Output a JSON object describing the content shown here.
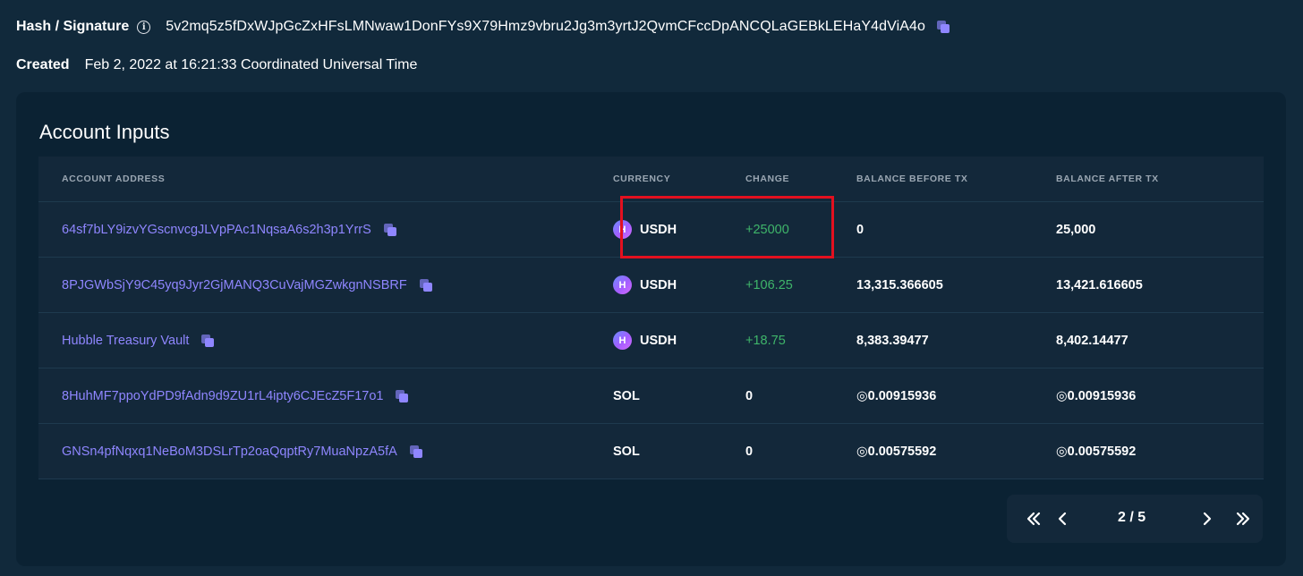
{
  "hash": {
    "label": "Hash / Signature",
    "info_icon": "info-icon",
    "value": "5v2mq5z5fDxWJpGcZxHFsLMNwaw1DonFYs9X79Hmz9vbru2Jg3m3yrtJ2QvmCFccDpANCQLaGEBkLEHaY4dViA4o",
    "copy_icon": "copy-icon"
  },
  "created": {
    "label": "Created",
    "value": "Feb 2, 2022 at 16:21:33 Coordinated Universal Time"
  },
  "account_inputs": {
    "title": "Account Inputs",
    "columns": [
      "ACCOUNT ADDRESS",
      "CURRENCY",
      "CHANGE",
      "BALANCE BEFORE TX",
      "BALANCE AFTER TX"
    ],
    "rows": [
      {
        "address": "64sf7bLY9izvYGscnvcgJLVpPAc1NqsaA6s2h3p1YrrS",
        "currency": "USDH",
        "currency_icon_letter": "H",
        "change": "+25000",
        "before": "0",
        "after": "25,000"
      },
      {
        "address": "8PJGWbSjY9C45yq9Jyr2GjMANQ3CuVajMGZwkgnNSBRF",
        "currency": "USDH",
        "currency_icon_letter": "H",
        "change": "+106.25",
        "before": "13,315.366605",
        "after": "13,421.616605"
      },
      {
        "address": "Hubble Treasury Vault",
        "currency": "USDH",
        "currency_icon_letter": "H",
        "change": "+18.75",
        "before": "8,383.39477",
        "after": "8,402.14477"
      },
      {
        "address": "8HuhMF7ppoYdPD9fAdn9d9ZU1rL4ipty6CJEcZ5F17o1",
        "currency": "SOL",
        "currency_icon_letter": "",
        "change": "0",
        "before": "◎0.00915936",
        "after": "◎0.00915936"
      },
      {
        "address": "GNSn4pfNqxq1NeBoM3DSLrTp2oaQqptRy7MuaNpzA5fA",
        "currency": "SOL",
        "currency_icon_letter": "",
        "change": "0",
        "before": "◎0.00575592",
        "after": "◎0.00575592"
      }
    ]
  },
  "pagination": {
    "page_text": "2 / 5",
    "icons": [
      "first-page-icon",
      "prev-page-icon",
      "next-page-icon",
      "last-page-icon"
    ]
  },
  "colors": {
    "background": "#11293b",
    "card": "#0b2233",
    "table": "#13283a",
    "link": "#8f86ff",
    "positive": "#3fb56a",
    "highlight": "#e3101f"
  }
}
